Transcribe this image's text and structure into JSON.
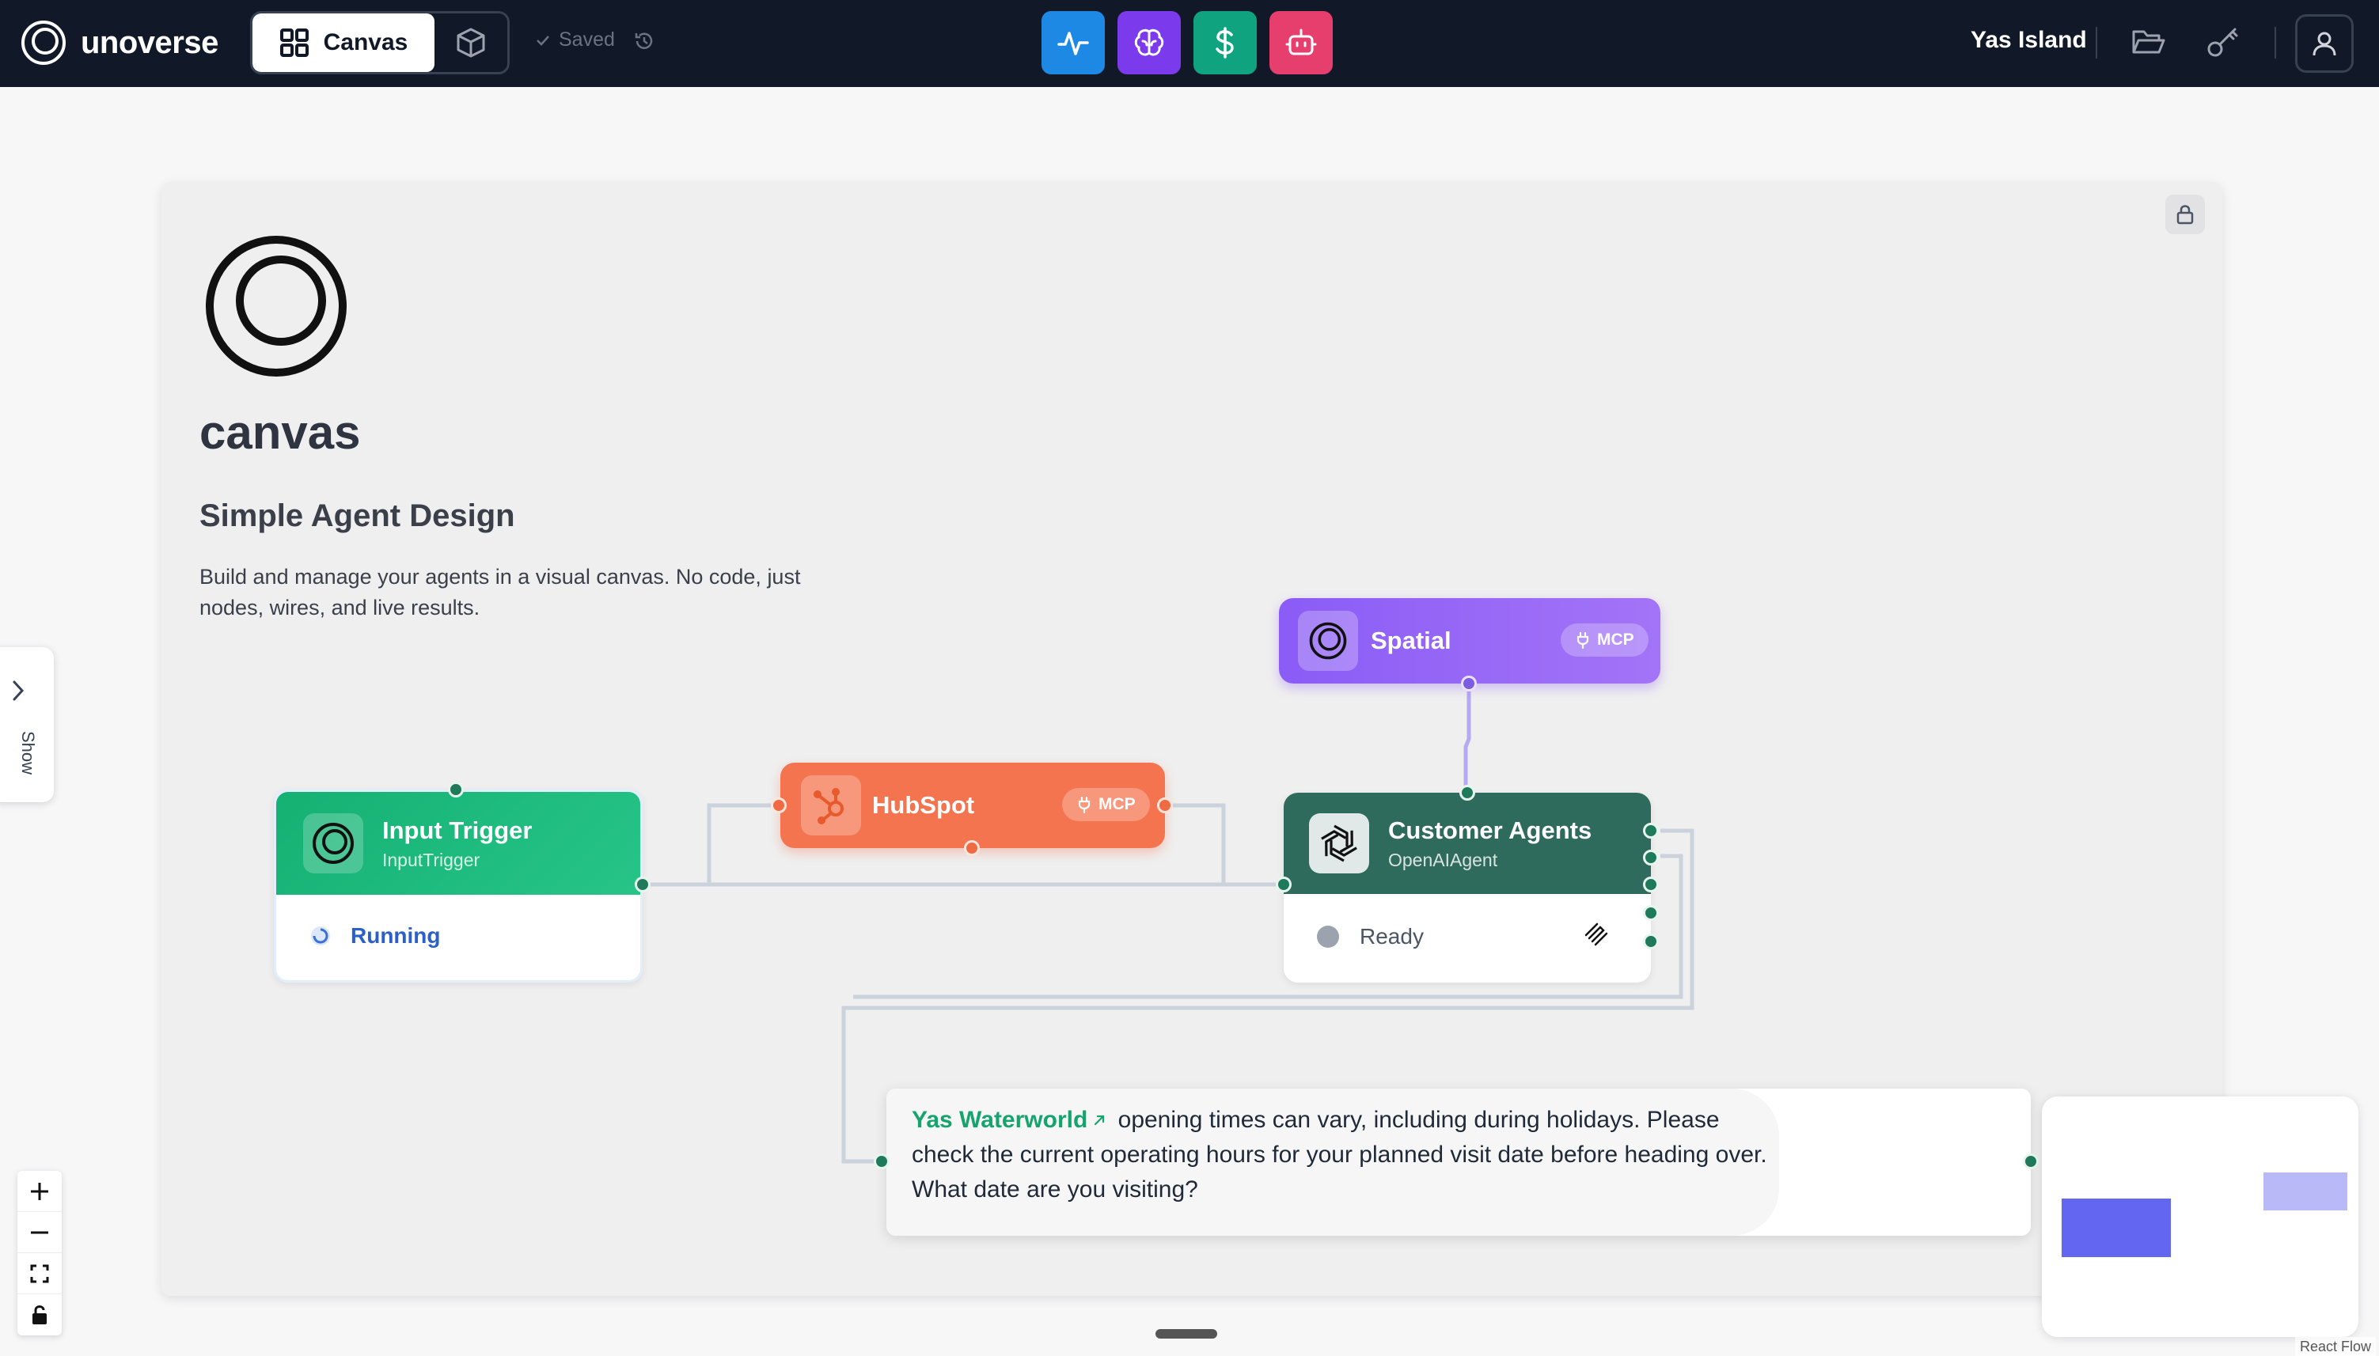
{
  "app": {
    "name": "unoverse"
  },
  "header": {
    "tab_canvas_label": "Canvas",
    "tab_3d_icon": "cube-icon",
    "save_status": "Saved",
    "tool_buttons": [
      {
        "name": "activity-button",
        "icon": "activity-icon",
        "color": "#1e88e5"
      },
      {
        "name": "brain-button",
        "icon": "brain-icon",
        "color": "#7c3aed"
      },
      {
        "name": "dollar-button",
        "icon": "dollar-icon",
        "color": "#10a37f"
      },
      {
        "name": "bot-button",
        "icon": "bot-icon",
        "color": "#e63e6d"
      }
    ],
    "workspace": "Yas Island",
    "right_icons": [
      "folder-open-icon",
      "key-icon",
      "user-icon"
    ]
  },
  "board": {
    "title": "canvas",
    "subtitle": "Simple Agent Design",
    "description": "Build and manage your agents in a visual canvas. No code, just nodes, wires, and live results."
  },
  "nodes": {
    "input_trigger": {
      "title": "Input Trigger",
      "type": "InputTrigger",
      "status": "Running",
      "color": "#17b978"
    },
    "hubspot": {
      "title": "HubSpot",
      "badge": "MCP",
      "color": "#f4744f"
    },
    "spatial": {
      "title": "Spatial",
      "badge": "MCP",
      "color": "#8b5cf6"
    },
    "customer_agents": {
      "title": "Customer Agents",
      "type": "OpenAIAgent",
      "status": "Ready",
      "color": "#2f6b5c"
    }
  },
  "chat": {
    "link_text": "Yas Waterworld",
    "message": " opening times can vary, including during holidays. Please check the current operating hours for your planned visit date before heading over. What date are you visiting?"
  },
  "sidebar": {
    "show_label": "Show"
  },
  "controls": [
    "zoom-in-icon",
    "zoom-out-icon",
    "fit-view-icon",
    "lock-icon"
  ],
  "attribution": "React Flow"
}
